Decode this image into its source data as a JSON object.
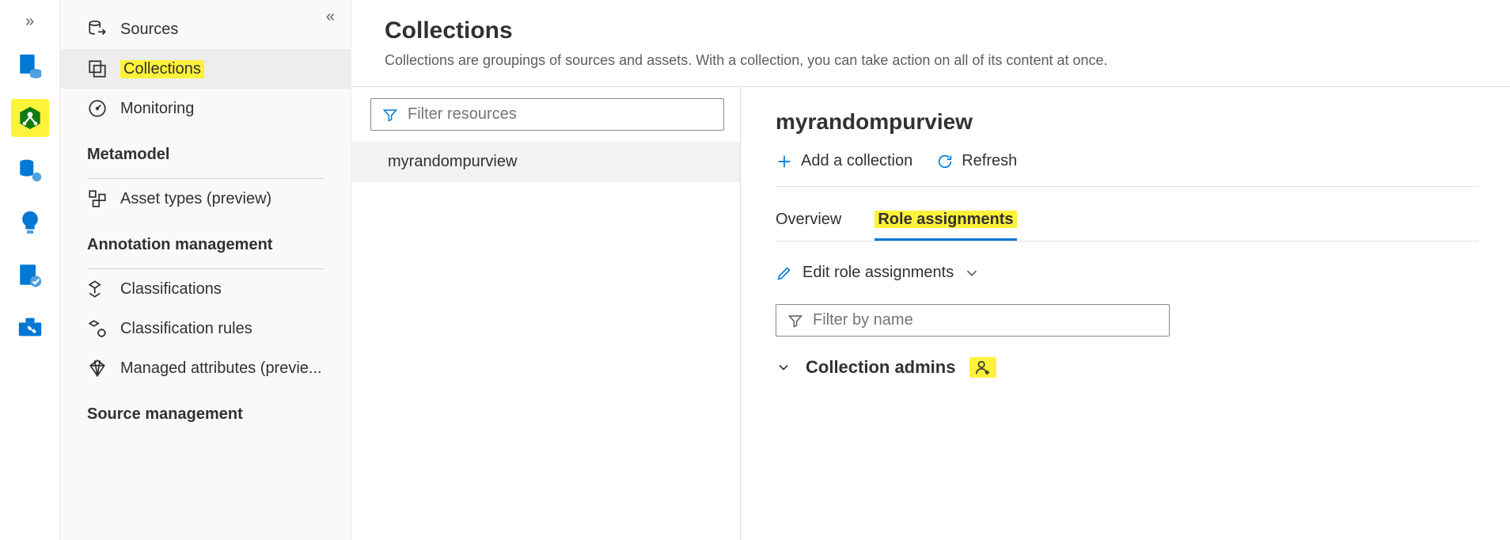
{
  "sidenav": {
    "items": [
      {
        "label": "Sources"
      },
      {
        "label": "Collections"
      },
      {
        "label": "Monitoring"
      }
    ],
    "section_metamodel": "Metamodel",
    "asset_types": "Asset types (preview)",
    "section_annotation": "Annotation management",
    "classifications": "Classifications",
    "classification_rules": "Classification rules",
    "managed_attributes": "Managed attributes (previe...",
    "section_source": "Source management"
  },
  "page": {
    "title": "Collections",
    "description": "Collections are groupings of sources and assets. With a collection, you can take action on all of its content at once.",
    "filter_placeholder": "Filter resources"
  },
  "list": {
    "item0": "myrandompurview"
  },
  "detail": {
    "title": "myrandompurview",
    "add_collection": "Add a collection",
    "refresh": "Refresh",
    "tab_overview": "Overview",
    "tab_roles": "Role assignments",
    "edit_roles": "Edit role assignments",
    "filter_name_placeholder": "Filter by name",
    "collection_admins": "Collection admins"
  }
}
